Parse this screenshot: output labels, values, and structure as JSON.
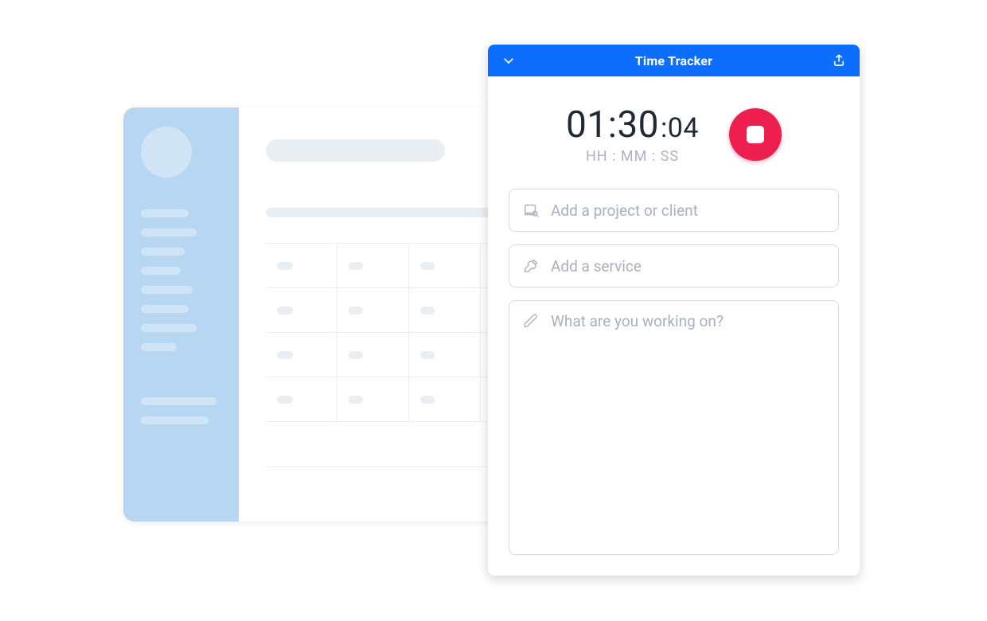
{
  "tracker": {
    "title": "Time Tracker",
    "timer": {
      "hh_mm": "01:30",
      "ss": ":04",
      "format": "HH : MM : SS"
    },
    "fields": {
      "project_placeholder": "Add a project or client",
      "service_placeholder": "Add a service",
      "notes_placeholder": "What are you working on?"
    },
    "icons": {
      "collapse": "chevron-down-icon",
      "share": "share-icon",
      "stop": "stop-icon",
      "project": "folder-search-icon",
      "service": "tools-icon",
      "notes": "pencil-icon"
    }
  },
  "colors": {
    "accent": "#0d6efd",
    "stop": "#ed1f4f",
    "muted": "#a7b1bd",
    "bg_sidebar": "#b7d6f2"
  }
}
